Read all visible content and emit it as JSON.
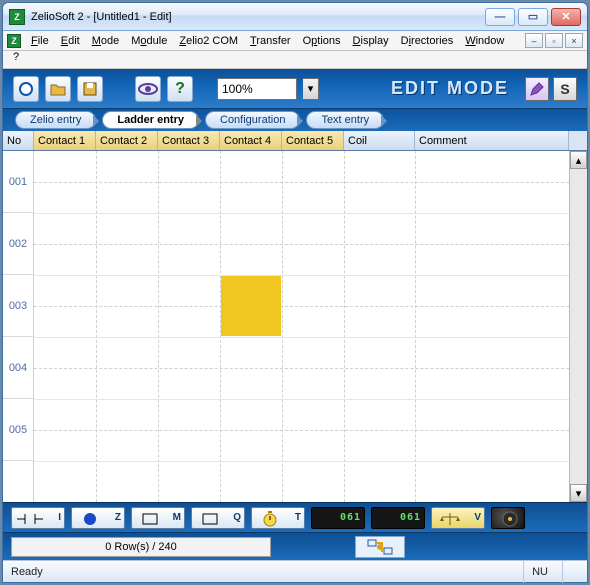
{
  "window": {
    "title": "ZelioSoft 2 - [Untitled1 - Edit]"
  },
  "menu": {
    "file": "File",
    "edit": "Edit",
    "mode": "Mode",
    "module": "Module",
    "zelio2com": "Zelio2 COM",
    "transfer": "Transfer",
    "options": "Options",
    "display": "Display",
    "directories": "Directories",
    "window": "Window",
    "help": "?"
  },
  "toolbar": {
    "zoom_value": "100%",
    "edit_mode_label": "EDIT MODE",
    "mode_s": "S"
  },
  "tabs": {
    "zelio": "Zelio entry",
    "ladder": "Ladder entry",
    "config": "Configuration",
    "text": "Text entry"
  },
  "columns": {
    "no": "No",
    "c1": "Contact 1",
    "c2": "Contact 2",
    "c3": "Contact 3",
    "c4": "Contact 4",
    "c5": "Contact 5",
    "coil": "Coil",
    "comment": "Comment"
  },
  "rows": [
    "001",
    "002",
    "003",
    "004",
    "005"
  ],
  "toolbox": {
    "i": "I",
    "z": "Z",
    "m": "M",
    "q": "Q",
    "t": "T",
    "counter1": "061",
    "counter2": "061",
    "v": "V"
  },
  "status": {
    "count": "0 Row(s) / 240"
  },
  "footer": {
    "ready": "Ready",
    "caps": "NU"
  }
}
